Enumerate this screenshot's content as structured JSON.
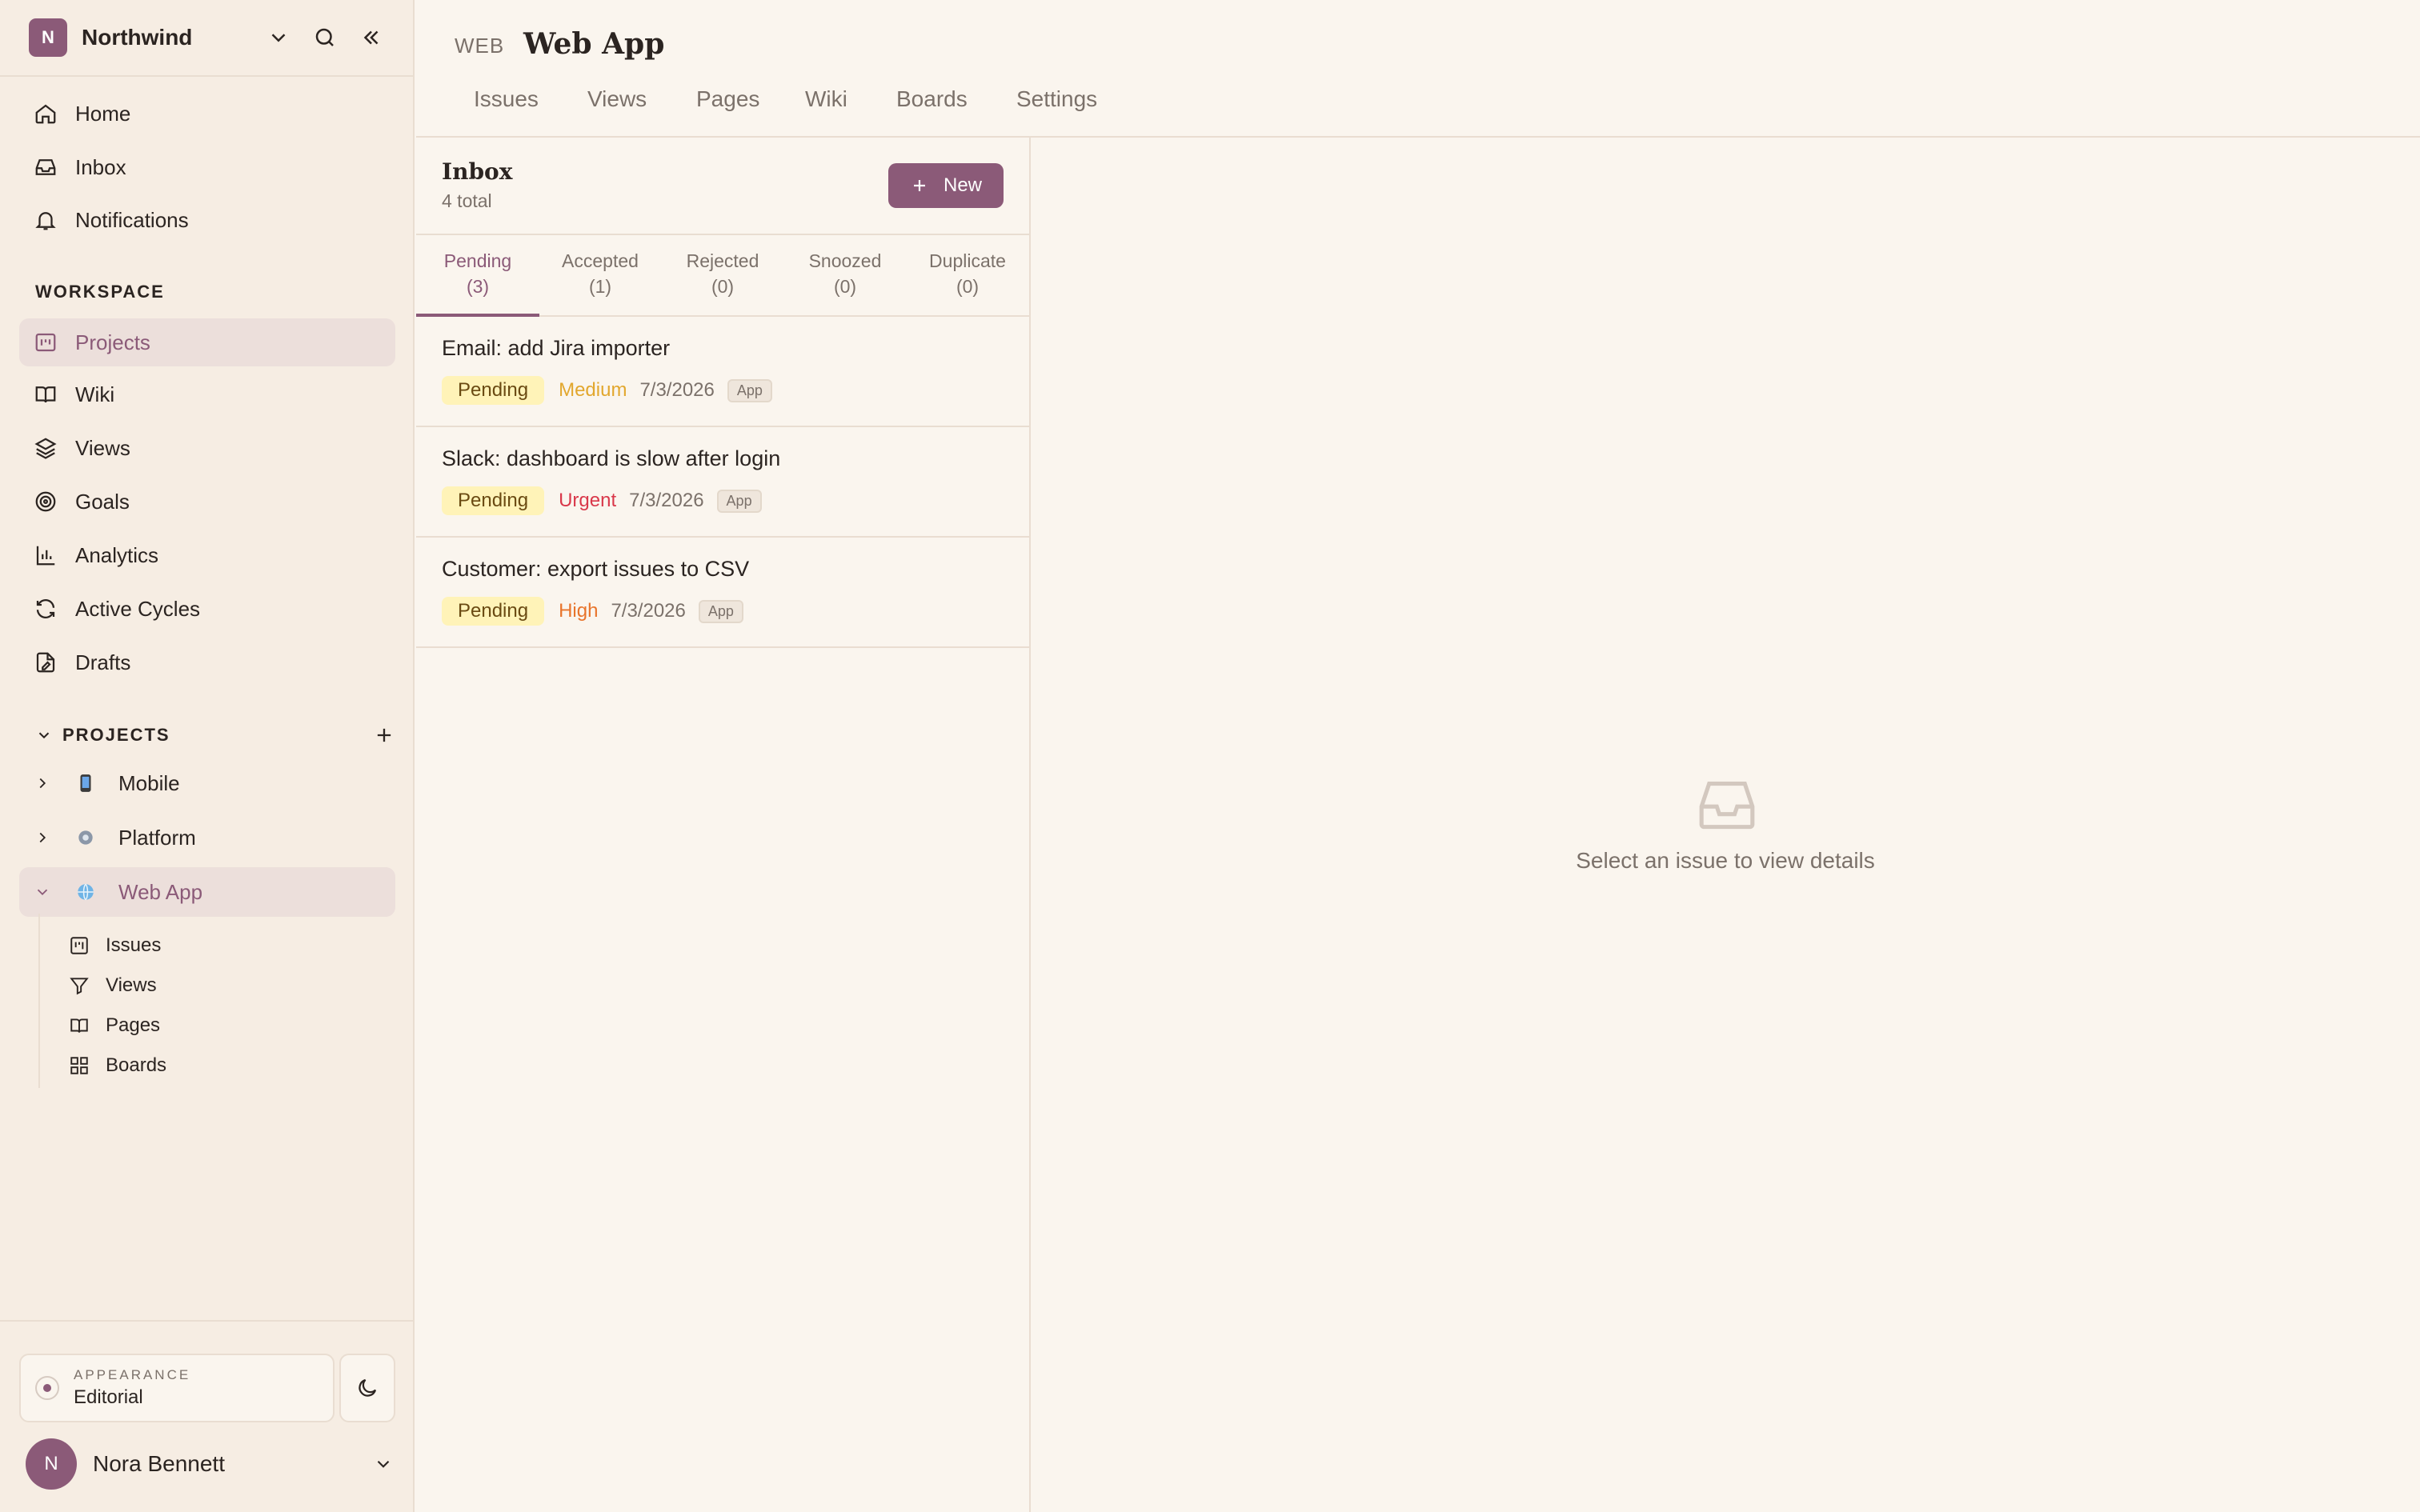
{
  "workspace": {
    "initial": "N",
    "name": "Northwind"
  },
  "nav": {
    "home": "Home",
    "inbox": "Inbox",
    "notifications": "Notifications"
  },
  "workspace_section": {
    "label": "WORKSPACE",
    "items": [
      "Projects",
      "Wiki",
      "Views",
      "Goals",
      "Analytics",
      "Active Cycles",
      "Drafts"
    ]
  },
  "projects_section": {
    "label": "PROJECTS",
    "items": [
      "Mobile",
      "Platform",
      "Web App"
    ],
    "sub_items": [
      "Issues",
      "Views",
      "Pages",
      "Boards"
    ]
  },
  "appearance": {
    "label": "APPEARANCE",
    "value": "Editorial"
  },
  "user": {
    "initial": "N",
    "name": "Nora Bennett"
  },
  "header": {
    "project_key": "WEB",
    "project_title": "Web App",
    "tabs": [
      "Issues",
      "Views",
      "Pages",
      "Wiki",
      "Boards",
      "Settings"
    ]
  },
  "inbox": {
    "title": "Inbox",
    "count": "4 total",
    "new_label": "New",
    "tabs": [
      {
        "label": "Pending",
        "count": "(3)"
      },
      {
        "label": "Accepted",
        "count": "(1)"
      },
      {
        "label": "Rejected",
        "count": "(0)"
      },
      {
        "label": "Snoozed",
        "count": "(0)"
      },
      {
        "label": "Duplicate",
        "count": "(0)"
      }
    ],
    "issues": [
      {
        "title": "Email: add Jira importer",
        "status": "Pending",
        "priority": "Medium",
        "priority_color": "#e2a72e",
        "date": "7/3/2026",
        "tag": "App"
      },
      {
        "title": "Slack: dashboard is slow after login",
        "status": "Pending",
        "priority": "Urgent",
        "priority_color": "#d9384a",
        "date": "7/3/2026",
        "tag": "App"
      },
      {
        "title": "Customer: export issues to CSV",
        "status": "Pending",
        "priority": "High",
        "priority_color": "#e8742b",
        "date": "7/3/2026",
        "tag": "App"
      }
    ]
  },
  "detail": {
    "empty_text": "Select an issue to view details"
  },
  "colors": {
    "accent": "#8b5a78",
    "sidebar": "#f6ede3",
    "background": "#faf5ee"
  }
}
